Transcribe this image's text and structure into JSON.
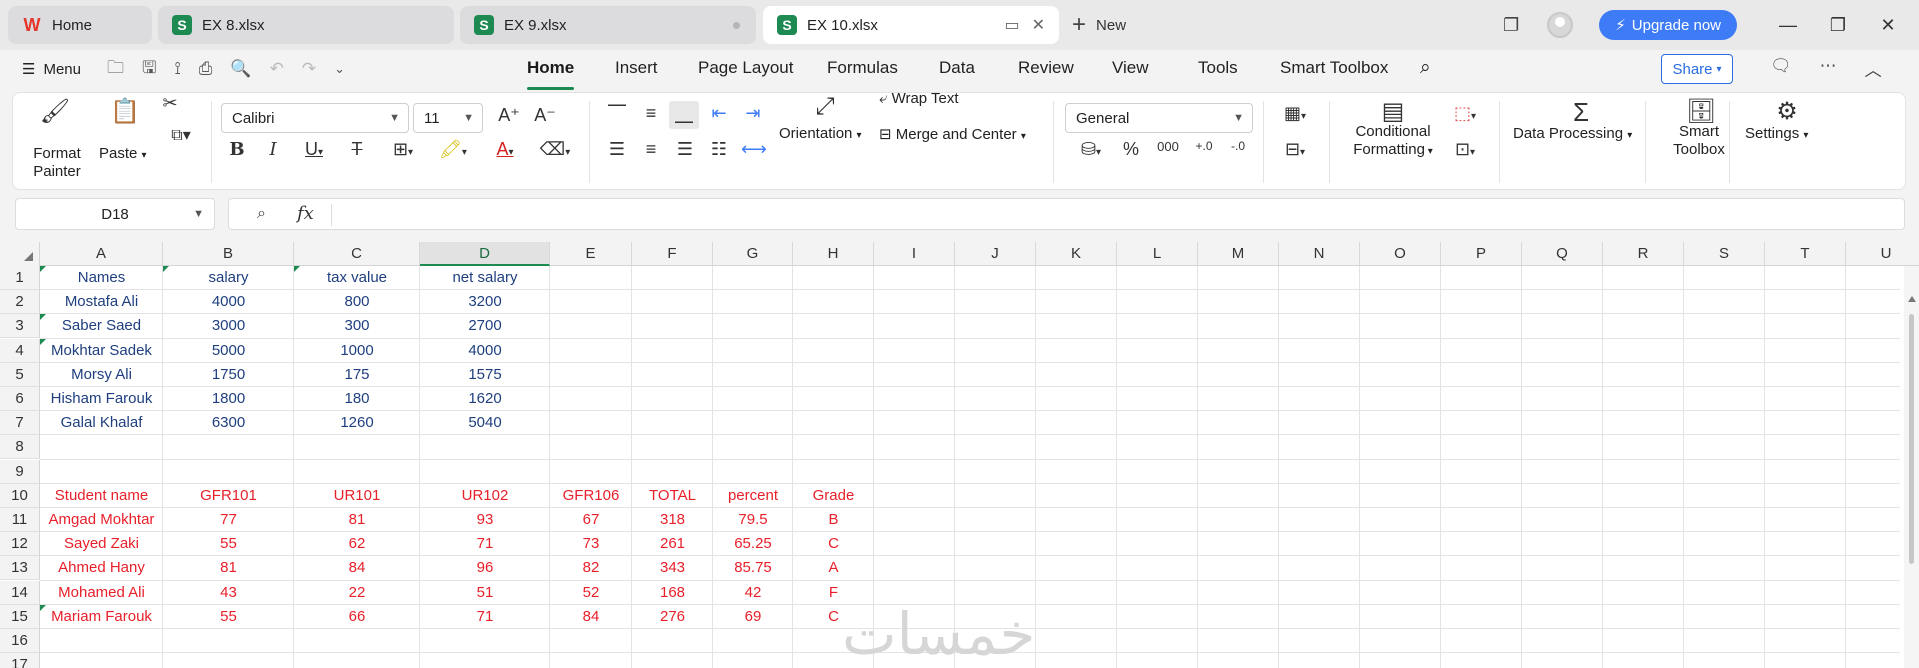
{
  "tabs": [
    {
      "label": "Home",
      "icon": "wps-logo-icon",
      "color": "#e5362b"
    },
    {
      "label": "EX 8.xlsx",
      "icon": "sheet-file-icon",
      "color": "#1d8a52"
    },
    {
      "label": "EX 9.xlsx",
      "icon": "sheet-file-icon",
      "color": "#1d8a52"
    },
    {
      "label": "EX 10.xlsx",
      "icon": "sheet-file-icon",
      "color": "#1d8a52"
    }
  ],
  "new_tab_label": "New",
  "upgrade_label": "Upgrade now",
  "menu_label": "Menu",
  "ribbon_tabs": [
    "Home",
    "Insert",
    "Page Layout",
    "Formulas",
    "Data",
    "Review",
    "View",
    "Tools",
    "Smart Toolbox"
  ],
  "active_tab": "Home",
  "share_label": "Share",
  "ribbon": {
    "format_painter": [
      "Format",
      "Painter"
    ],
    "paste": "Paste",
    "font_name": "Calibri",
    "font_size": "11",
    "wrap_text": "Wrap Text",
    "orientation": "Orientation",
    "merge_center": "Merge and Center",
    "number_format": "General",
    "conditional_formatting": [
      "Conditional",
      "Formatting"
    ],
    "data_processing": "Data Processing",
    "smart_toolbox": [
      "Smart",
      "Toolbox"
    ],
    "settings": "Settings"
  },
  "name_box": "D18",
  "formula_value": "",
  "columns": [
    "A",
    "B",
    "C",
    "D",
    "E",
    "F",
    "G",
    "H",
    "I",
    "J",
    "K",
    "L",
    "M",
    "N",
    "O",
    "P",
    "Q",
    "R",
    "S",
    "T",
    "U"
  ],
  "selected_column": "D",
  "rows": [
    "1",
    "2",
    "3",
    "4",
    "5",
    "6",
    "7",
    "8",
    "9",
    "10",
    "11",
    "12",
    "13",
    "14",
    "15",
    "16",
    "17"
  ],
  "table1": {
    "headers": [
      "Names",
      "salary",
      "tax value",
      "net salary"
    ],
    "rows": [
      [
        "Mostafa Ali",
        "4000",
        "800",
        "3200"
      ],
      [
        "Saber Saed",
        "3000",
        "300",
        "2700"
      ],
      [
        "Mokhtar Sadek",
        "5000",
        "1000",
        "4000"
      ],
      [
        "Morsy Ali",
        "1750",
        "175",
        "1575"
      ],
      [
        "Hisham Farouk",
        "1800",
        "180",
        "1620"
      ],
      [
        "Galal Khalaf",
        "6300",
        "1260",
        "5040"
      ]
    ]
  },
  "table2": {
    "headers": [
      "Student name",
      "GFR101",
      "UR101",
      "UR102",
      "GFR106",
      "TOTAL",
      "percent",
      "Grade"
    ],
    "rows": [
      [
        "Amgad Mokhtar",
        "77",
        "81",
        "93",
        "67",
        "318",
        "79.5",
        "B"
      ],
      [
        "Sayed Zaki",
        "55",
        "62",
        "71",
        "73",
        "261",
        "65.25",
        "C"
      ],
      [
        "Ahmed Hany",
        "81",
        "84",
        "96",
        "82",
        "343",
        "85.75",
        "A"
      ],
      [
        "Mohamed Ali",
        "43",
        "22",
        "51",
        "52",
        "168",
        "42",
        "F"
      ],
      [
        "Mariam Farouk",
        "55",
        "66",
        "71",
        "84",
        "276",
        "69",
        "C"
      ]
    ]
  },
  "text_colors": {
    "table1": "#1f3f7f",
    "table2": "#e8202a",
    "accent": "#1d8a52"
  },
  "watermark": "خمسات"
}
